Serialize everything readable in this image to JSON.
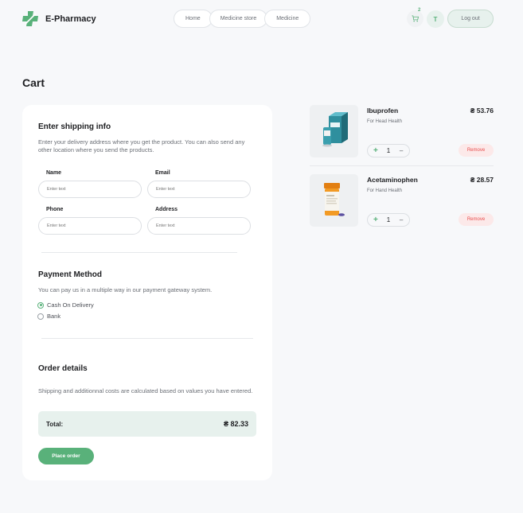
{
  "header": {
    "logo_text": "E-Pharmacy",
    "nav": [
      "Home",
      "Medicine store",
      "Medicine"
    ],
    "cart_count": "2",
    "avatar_letter": "T",
    "logout_label": "Log out"
  },
  "page_title": "Cart",
  "shipping": {
    "title": "Enter shipping info",
    "description": "Enter your delivery address where you get the product. You can also send any other location where you send the products.",
    "fields": {
      "name_label": "Name",
      "name_placeholder": "Enter text",
      "email_label": "Email",
      "email_placeholder": "Enter text",
      "phone_label": "Phone",
      "phone_placeholder": "Enter text",
      "address_label": "Address",
      "address_placeholder": "Enter text"
    }
  },
  "payment": {
    "title": "Payment Method",
    "description": "You can pay us in a multiple way in our payment gateway system.",
    "options": [
      "Cash On Delivery",
      "Bank"
    ],
    "selected": "Cash On Delivery"
  },
  "order": {
    "title": "Order details",
    "description": "Shipping and additionnal costs are calculated based on values you have entered.",
    "total_label": "Total:",
    "total_value": "₴ 82.33",
    "place_order_label": "Place order"
  },
  "products": [
    {
      "name": "Ibuprofen",
      "subtitle": "For Head Health",
      "price": "₴ 53.76",
      "quantity": "1",
      "remove_label": "Remove",
      "plus": "+",
      "minus": "–"
    },
    {
      "name": "Acetaminophen",
      "subtitle": "For Hand Health",
      "price": "₴ 28.57",
      "quantity": "1",
      "remove_label": "Remove",
      "plus": "+",
      "minus": "–"
    }
  ],
  "colors": {
    "accent": "#59b17a",
    "accent_light": "#e7f1ed",
    "danger": "#e85050",
    "background": "#f7f8fa"
  }
}
